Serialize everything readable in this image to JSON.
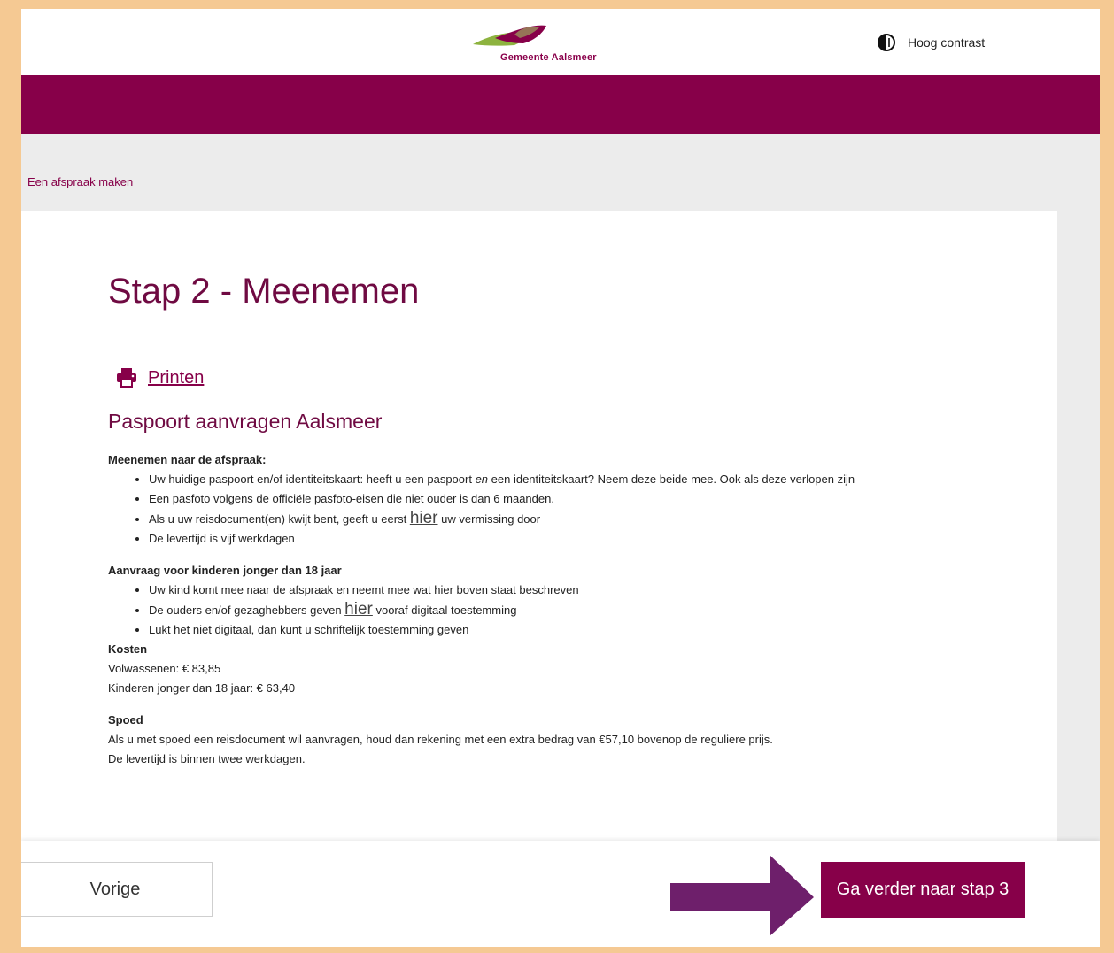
{
  "header": {
    "logo_text": "Gemeente Aalsmeer",
    "contrast_label": "Hoog contrast"
  },
  "breadcrumb": "Een afspraak maken",
  "main": {
    "title": "Stap 2 - Meenemen",
    "print_label": "Printen",
    "section_title": "Paspoort aanvragen Aalsmeer",
    "bring": {
      "heading": "Meenemen naar de afspraak:",
      "item1_a": "Uw huidige paspoort en/of identiteitskaart: heeft u een paspoort ",
      "item1_em": "en",
      "item1_b": " een identiteitskaart? Neem deze beide mee. Ook als deze verlopen zijn",
      "item2": "Een pasfoto volgens de officiële pasfoto-eisen die niet ouder is dan 6 maanden.",
      "item3_a": "Als u uw reisdocument(en) kwijt bent, geeft u eerst ",
      "item3_link": "hier",
      "item3_b": " uw vermissing door",
      "item4": "De levertijd is vijf werkdagen"
    },
    "children": {
      "heading": "Aanvraag voor kinderen jonger dan 18 jaar",
      "item1": "Uw kind komt mee naar de afspraak en neemt mee wat hier boven staat beschreven",
      "item2_a": "De ouders en/of gezaghebbers geven ",
      "item2_link": "hier",
      "item2_b": " vooraf digitaal toestemming",
      "item3": "Lukt het niet digitaal, dan kunt u schriftelijk toestemming geven"
    },
    "costs": {
      "heading": "Kosten",
      "adults": "Volwassenen: € 83,85",
      "children": "Kinderen jonger dan 18 jaar: € 63,40"
    },
    "urgent": {
      "heading": "Spoed",
      "line1": "Als u met spoed een reisdocument wil aanvragen, houd dan rekening met een extra bedrag van €57,10 bovenop de reguliere prijs.",
      "line2": "De levertijd is binnen twee werkdagen."
    }
  },
  "footer": {
    "prev_label": "Vorige",
    "next_label": "Ga verder naar stap 3"
  },
  "icons": {
    "contrast": "contrast-icon",
    "print": "printer-icon",
    "arrow": "arrow-right-icon"
  },
  "colors": {
    "brand": "#870049",
    "arrow": "#6e1f6b",
    "border": "#f5c993"
  }
}
